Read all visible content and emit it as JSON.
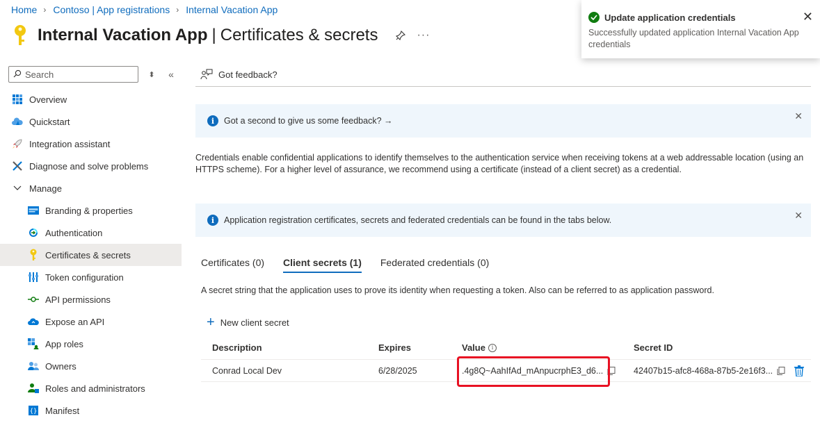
{
  "breadcrumb": [
    "Home",
    "Contoso | App registrations",
    "Internal Vacation App"
  ],
  "title": {
    "app": "Internal Vacation App",
    "separator": "|",
    "page": "Certificates & secrets",
    "more": "···"
  },
  "search": {
    "placeholder": "Search"
  },
  "nav": {
    "items": [
      {
        "label": "Overview",
        "icon": "overview-icon"
      },
      {
        "label": "Quickstart",
        "icon": "quickstart-icon"
      },
      {
        "label": "Integration assistant",
        "icon": "rocket-icon"
      },
      {
        "label": "Diagnose and solve problems",
        "icon": "wrench-icon"
      }
    ],
    "group": "Manage",
    "sub_items": [
      {
        "label": "Branding & properties",
        "icon": "branding-icon"
      },
      {
        "label": "Authentication",
        "icon": "authentication-icon"
      },
      {
        "label": "Certificates & secrets",
        "icon": "key-icon",
        "active": true
      },
      {
        "label": "Token configuration",
        "icon": "token-icon"
      },
      {
        "label": "API permissions",
        "icon": "api-permissions-icon"
      },
      {
        "label": "Expose an API",
        "icon": "cloud-icon"
      },
      {
        "label": "App roles",
        "icon": "app-roles-icon"
      },
      {
        "label": "Owners",
        "icon": "owners-icon"
      },
      {
        "label": "Roles and administrators",
        "icon": "roles-icon"
      },
      {
        "label": "Manifest",
        "icon": "manifest-icon"
      }
    ]
  },
  "feedback": {
    "label": "Got feedback?"
  },
  "banner1": {
    "text": "Got a second to give us some feedback? →"
  },
  "description": "Credentials enable confidential applications to identify themselves to the authentication service when receiving tokens at a web addressable location (using an HTTPS scheme). For a higher level of assurance, we recommend using a certificate (instead of a client secret) as a credential.",
  "banner2": {
    "text": "Application registration certificates, secrets and federated credentials can be found in the tabs below."
  },
  "tabs": [
    {
      "label": "Certificates (0)"
    },
    {
      "label": "Client secrets (1)",
      "active": true
    },
    {
      "label": "Federated credentials (0)"
    }
  ],
  "tab_description": "A secret string that the application uses to prove its identity when requesting a token. Also can be referred to as application password.",
  "new_secret_label": "New client secret",
  "table": {
    "headers": {
      "description": "Description",
      "expires": "Expires",
      "value": "Value",
      "secret_id": "Secret ID"
    },
    "rows": [
      {
        "description": "Conrad Local Dev",
        "expires": "6/28/2025",
        "value": ".4g8Q~AahIfAd_mAnpucrphE3_d6...",
        "secret_id": "42407b15-afc8-468a-87b5-2e16f3..."
      }
    ]
  },
  "toast": {
    "title": "Update application credentials",
    "body": "Successfully updated application Internal Vacation App credentials"
  },
  "colors": {
    "accent": "#0f6cbd",
    "highlight": "#e81123",
    "success": "#107c10",
    "banner_bg": "#eff6fc",
    "active_nav_bg": "#edebe9"
  }
}
